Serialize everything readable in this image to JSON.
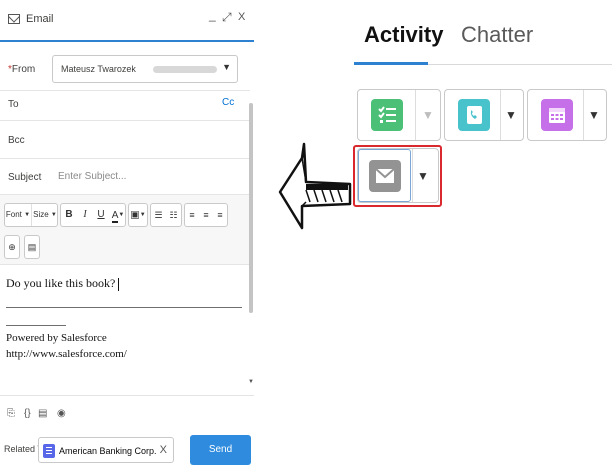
{
  "composer": {
    "title": "Email",
    "minimize": "_",
    "expand": "⤢",
    "close": "X",
    "from_label": "From",
    "from_required": "*",
    "from_value": "Mateusz Twarozek",
    "to_label": "To",
    "cc_link": "Cc",
    "bcc_label": "Bcc",
    "subject_label": "Subject",
    "subject_placeholder": "Enter Subject...",
    "toolbar": {
      "font": "Font",
      "size": "Size",
      "bold": "B",
      "italic": "I",
      "underline": "U",
      "text_color": "A"
    },
    "body_line1": "Do you like this book?",
    "signature_line1": "Powered by Salesforce",
    "signature_line2": "http://www.salesforce.com/",
    "related_label": "Related To",
    "related_value": "American Banking Corp.",
    "related_clear": "X",
    "send_label": "Send"
  },
  "activity_panel": {
    "tabs": [
      {
        "label": "Activity",
        "selected": true
      },
      {
        "label": "Chatter",
        "selected": false
      }
    ],
    "actions": [
      {
        "name": "new-task",
        "icon": "task-checklist-icon",
        "color": "#4bc076"
      },
      {
        "name": "log-call",
        "icon": "phone-icon",
        "color": "#48c3cc"
      },
      {
        "name": "new-event",
        "icon": "calendar-icon",
        "color": "#eb7092"
      },
      {
        "name": "email",
        "icon": "email-icon",
        "color": "#939393",
        "highlighted": true
      }
    ],
    "dropdown_caret": "▼"
  },
  "colors": {
    "accent": "#2e80d1",
    "send_button": "#2e8bde",
    "highlight_border": "#d9282e"
  }
}
